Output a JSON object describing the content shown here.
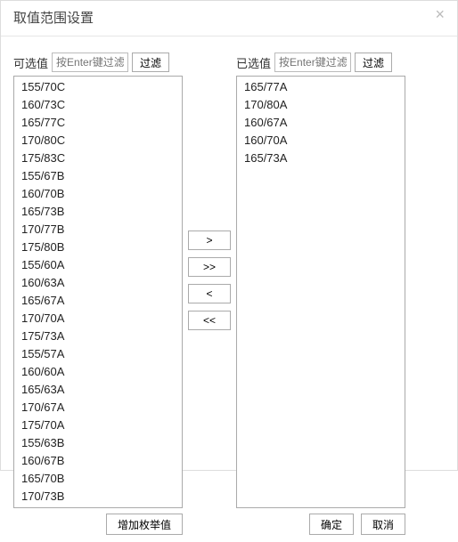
{
  "dialog": {
    "title": "取值范围设置",
    "close_label": "×"
  },
  "available": {
    "label": "可选值",
    "filter_placeholder": "按Enter键过滤",
    "filter_btn": "过滤",
    "items": [
      "155/70C",
      "160/73C",
      "165/77C",
      "170/80C",
      "175/83C",
      "155/67B",
      "160/70B",
      "165/73B",
      "170/77B",
      "175/80B",
      "155/60A",
      "160/63A",
      "165/67A",
      "170/70A",
      "175/73A",
      "155/57A",
      "160/60A",
      "165/63A",
      "170/67A",
      "175/70A",
      "155/63B",
      "160/67B",
      "165/70B",
      "170/73B"
    ]
  },
  "selected": {
    "label": "已选值",
    "filter_placeholder": "按Enter键过滤",
    "filter_btn": "过滤",
    "items": [
      "165/77A",
      "170/80A",
      "160/67A",
      "160/70A",
      "165/73A"
    ]
  },
  "move_buttons": {
    "add_one": ">",
    "add_all": ">>",
    "remove_one": "<",
    "remove_all": "<<"
  },
  "footer": {
    "add_enum": "增加枚举值",
    "ok": "确定",
    "cancel": "取消"
  }
}
